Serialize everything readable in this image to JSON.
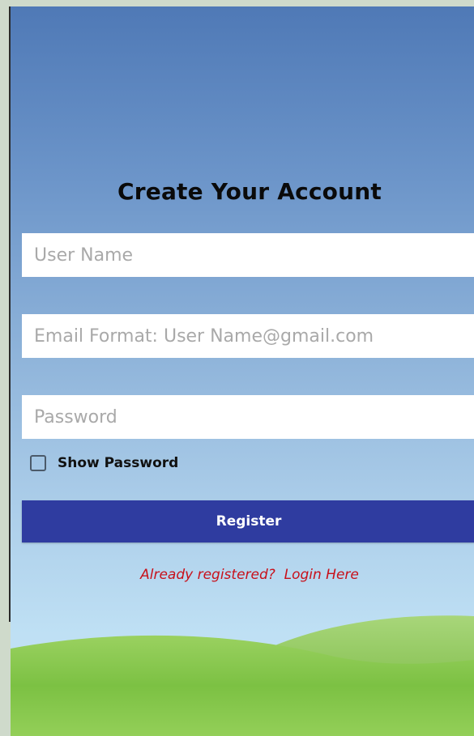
{
  "form": {
    "title": "Create Your Account",
    "username_placeholder": "User Name",
    "email_placeholder": "Email Format: User Name@gmail.com",
    "password_placeholder": "Password",
    "show_password_label": "Show Password",
    "show_password_checked": false,
    "register_label": "Register",
    "login_prompt": "Already registered?  Login Here"
  },
  "colors": {
    "register_button": "#2f3ca0",
    "login_link": "#c8101a",
    "sky_top": "#4f79b6",
    "sky_bottom": "#c4e4f6",
    "hill_green": "#7fc041"
  }
}
